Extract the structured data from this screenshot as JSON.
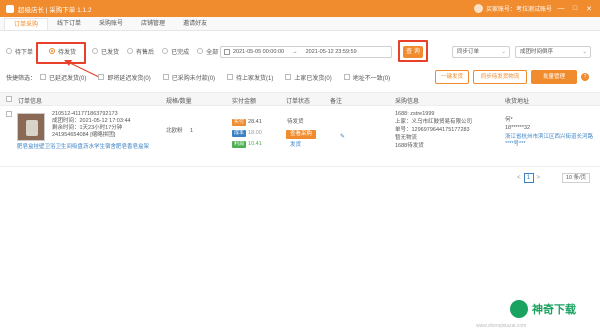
{
  "app": {
    "title": "超级店长 | 采购下单 1.1.2",
    "user": "买家账号：考拉测试账号",
    "win_min": "—",
    "win_max": "□",
    "win_close": "✕"
  },
  "nav": {
    "tabs": [
      "订单采购",
      "线下订单",
      "采购账号",
      "店铺管理",
      "邀请好友"
    ],
    "active_index": 0
  },
  "filters": {
    "radios": [
      "待下单",
      "待发货",
      "已发货",
      "有售后",
      "已完成",
      "全部"
    ],
    "checked_index": 1,
    "date_start": "2021-05-05 00:00:00",
    "date_sep": "→",
    "date_end": "2021-05-12 23:59:59",
    "search_label": "查 询",
    "sync_select": "同步订单",
    "sort_select": "成团时间倒序"
  },
  "quick": {
    "label": "快捷筛选：",
    "items": [
      "已延迟发货(0)",
      "即将延迟发货(0)",
      "已采购未付款(0)",
      "待上家发货(1)",
      "上家已发货(0)",
      "地址不一致(0)"
    ],
    "btn_ship": "一键发货",
    "btn_sync_logistics": "同步待发货物流",
    "btn_batch": "批量管理",
    "help": "?"
  },
  "table": {
    "headers": [
      "订单信息",
      "规格/数量",
      "实付金额",
      "订单状态",
      "备注",
      "采购信息",
      "收货地址"
    ],
    "row": {
      "order_id": "210512-411771863792173",
      "order_time": "成团时间：2021-05-12 17:03:44",
      "countdown": "剩余时间：1天23小时17分钟",
      "logistics": "241954654084 [缩略拼团]",
      "product_title": "肥皂盒挂壁卫浴卫生间吸盘沥水学生宿舍肥皂香皂盒架",
      "spec": "北欧粉",
      "qty": "1",
      "amount_actual": "28.41",
      "amount_cost": "18.00",
      "amount_profit": "10.41",
      "tag_actual": "实付",
      "tag_cost": "成本",
      "tag_profit": "利润",
      "status": "待发货",
      "status_btn": "查看采购",
      "status_link": "发货",
      "purchase_acc": "1688: zstre1999",
      "supplier": "上家：义乌市红鼓贸易有限公司",
      "purchase_no": "单号：1296979644175177283",
      "logistics_status": "暂无物流",
      "purchase_status": "1688待发货",
      "receiver": "何*",
      "phone": "18******32",
      "address": "浙江省杭州市滨江区西兴街道长河路****号***"
    }
  },
  "pager": {
    "prev": "<",
    "page": "1",
    "next": ">",
    "size": "10 条/页"
  },
  "watermark": {
    "text": "神奇下载",
    "url": "www.shenqixiazai.com"
  }
}
